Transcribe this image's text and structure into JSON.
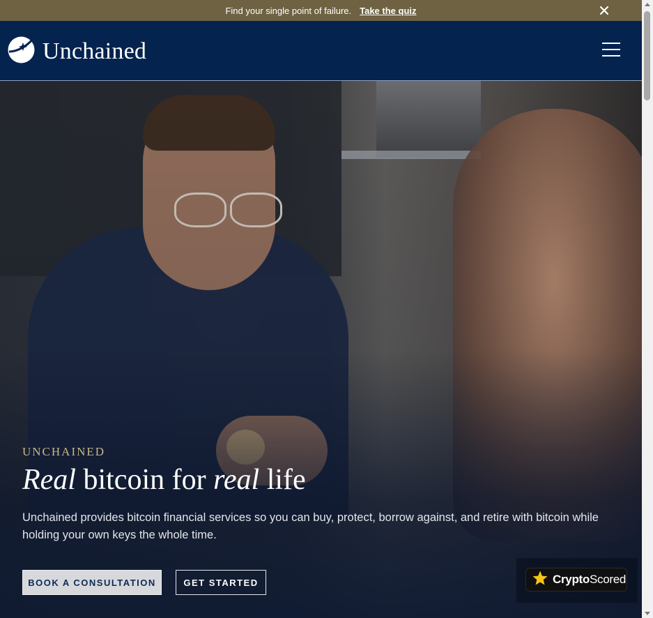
{
  "announcement": {
    "message": "Find your single point of failure.",
    "link_label": "Take the quiz",
    "close_icon": "close-icon"
  },
  "header": {
    "logo_text": "Unchained",
    "logo_icon": "star-globe-logo-icon",
    "menu_icon": "hamburger-menu-icon"
  },
  "hero": {
    "image": "photo-man-smiling-in-kitchen",
    "eyebrow": "UNCHAINED",
    "headline": {
      "part1_italic": "Real",
      "part2": " bitcoin for ",
      "part3_italic": "real",
      "part4": " life"
    },
    "subtext": "Unchained provides bitcoin financial services so you can buy, protect, borrow against, and retire with bitcoin while holding your own keys the whole time.",
    "primary_button": "BOOK A CONSULTATION",
    "secondary_button": "GET STARTED"
  },
  "badge": {
    "icon": "star-icon",
    "label_bold": "Crypto",
    "label_regular": "Scored"
  },
  "colors": {
    "announcement_bg": "#6f6243",
    "header_bg": "#04234f",
    "eyebrow": "#c9b88a",
    "primary_button_bg": "#d6d8dc",
    "primary_button_text": "#0d2a54",
    "star": "#f5c518"
  }
}
